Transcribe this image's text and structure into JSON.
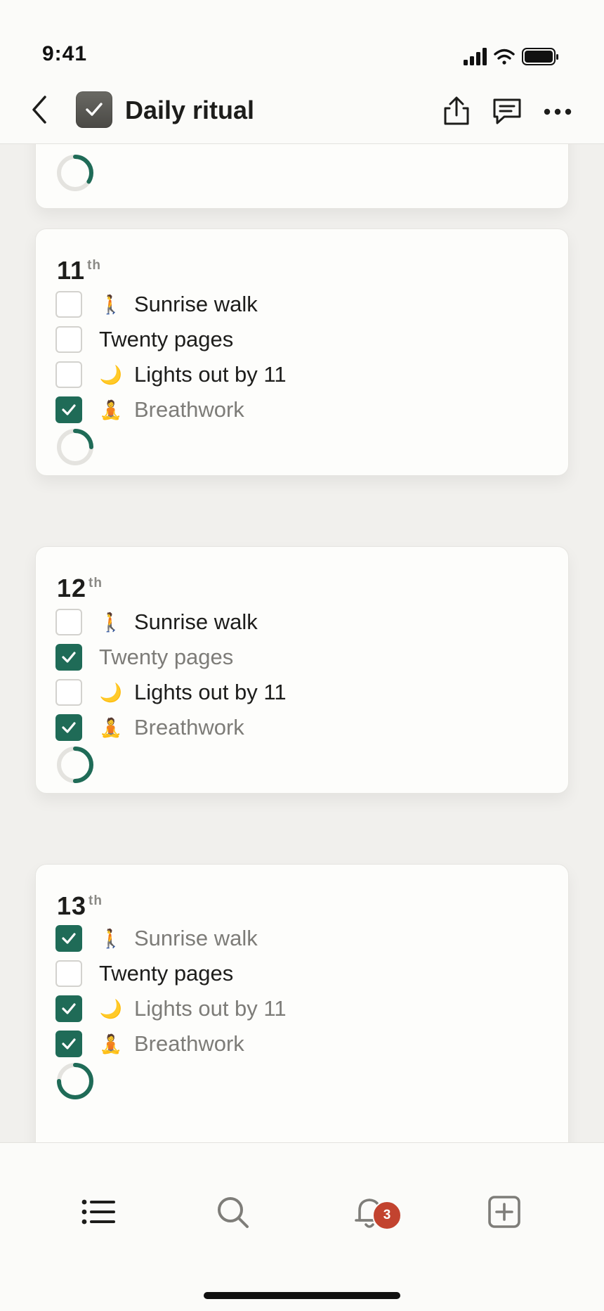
{
  "status_bar": {
    "time": "9:41"
  },
  "header": {
    "title": "Daily ritual"
  },
  "colors": {
    "accent": "#1f6b57",
    "badge": "#c2432f",
    "background": "#f1f0ed"
  },
  "cards": [
    {
      "day": "",
      "suffix": "",
      "completion": 0.34,
      "tasks": []
    },
    {
      "day": "11",
      "suffix": "th",
      "completion": 0.25,
      "tasks": [
        {
          "emoji": "🚶",
          "label": "Sunrise walk",
          "checked": false
        },
        {
          "emoji": "",
          "label": "Twenty pages",
          "checked": false
        },
        {
          "emoji": "🌙",
          "label": "Lights out by 11",
          "checked": false
        },
        {
          "emoji": "🧘",
          "label": "Breathwork",
          "checked": true
        }
      ]
    },
    {
      "day": "12",
      "suffix": "th",
      "completion": 0.5,
      "tasks": [
        {
          "emoji": "🚶",
          "label": "Sunrise walk",
          "checked": false
        },
        {
          "emoji": "",
          "label": "Twenty pages",
          "checked": true
        },
        {
          "emoji": "🌙",
          "label": "Lights out by 11",
          "checked": false
        },
        {
          "emoji": "🧘",
          "label": "Breathwork",
          "checked": true
        }
      ]
    },
    {
      "day": "13",
      "suffix": "th",
      "completion": 0.75,
      "tasks": [
        {
          "emoji": "🚶",
          "label": "Sunrise walk",
          "checked": true
        },
        {
          "emoji": "",
          "label": "Twenty pages",
          "checked": false
        },
        {
          "emoji": "🌙",
          "label": "Lights out by 11",
          "checked": true
        },
        {
          "emoji": "🧘",
          "label": "Breathwork",
          "checked": true
        }
      ]
    }
  ],
  "tabbar": {
    "notification_count": "3"
  }
}
